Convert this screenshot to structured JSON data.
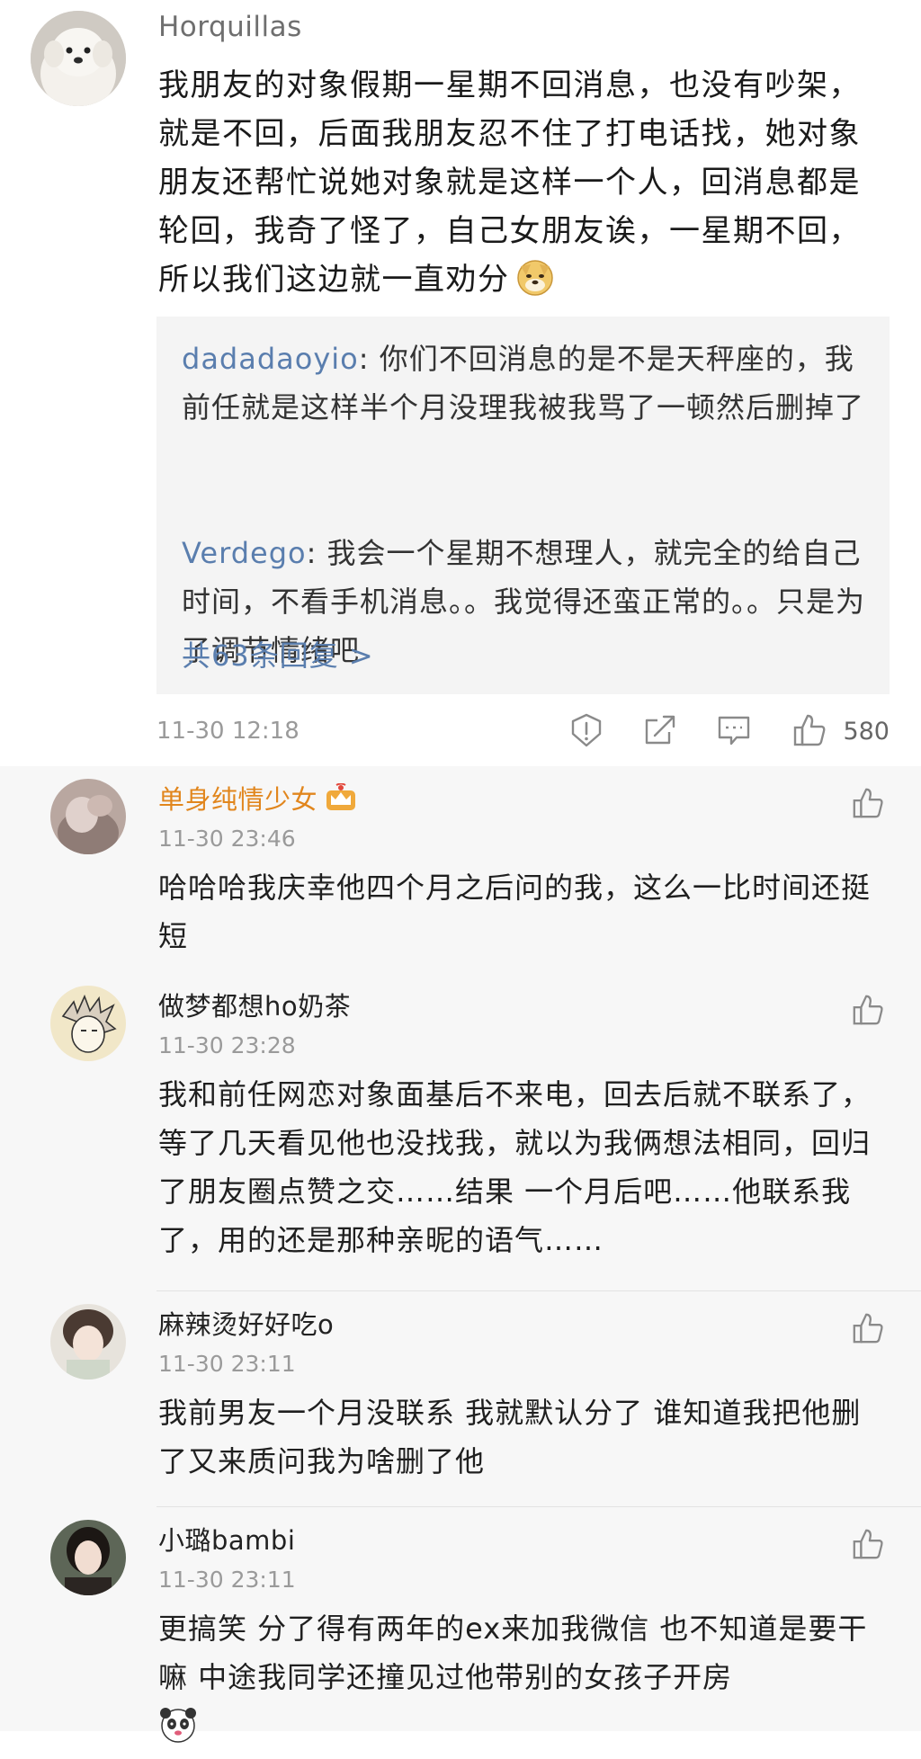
{
  "main": {
    "username": "Horquillas",
    "text": "我朋友的对象假期一星期不回消息，也没有吵架，就是不回，后面我朋友忍不住了打电话找，她对象朋友还帮忙说她对象就是这样一个人，回消息都是轮回，我奇了怪了，自己女朋友诶，一星期不回，所以我们这边就一直劝分",
    "emoji": "doge-emoji",
    "replies": [
      {
        "name": "dadadaoyio",
        "text": "你们不回消息的是不是天秤座的，我前任就是这样半个月没理我被我骂了一顿然后删掉了"
      },
      {
        "name": "Verdego",
        "text": "我会一个星期不想理人，就完全的给自己时间，不看手机消息。。我觉得还蛮正常的。。只是为了调节情绪吧"
      }
    ],
    "more_replies": "共63条回复 >",
    "timestamp": "11-30 12:18",
    "like_count": "580"
  },
  "sub_comments": [
    {
      "username": "单身纯情少女",
      "time": "11-30 23:46",
      "text": "哈哈哈我庆幸他四个月之后问的我，这么一比时间还挺短",
      "badge": "crown-badge"
    },
    {
      "username": "做梦都想ho奶茶",
      "time": "11-30 23:28",
      "text": "我和前任网恋对象面基后不来电，回去后就不联系了，等了几天看见他也没找我，就以为我俩想法相同，回归了朋友圈点赞之交……结果 一个月后吧……他联系我了，用的还是那种亲昵的语气……"
    },
    {
      "username": "麻辣烫好好吃o",
      "time": "11-30 23:11",
      "text": "我前男友一个月没联系 我就默认分了 谁知道我把他删了又来质问我为啥删了他"
    },
    {
      "username": "小璐bambi",
      "time": "11-30 23:11",
      "text": "更搞笑 分了得有两年的ex来加我微信 也不知道是要干嘛 中途我同学还撞见过他带别的女孩子开房",
      "emoji": "panda-emoji"
    }
  ],
  "colors": {
    "link_blue": "#5a7eae",
    "vip_orange": "#e1861d",
    "reply_bg": "#f4f4f4",
    "sub_bg": "#f7f7f7"
  }
}
